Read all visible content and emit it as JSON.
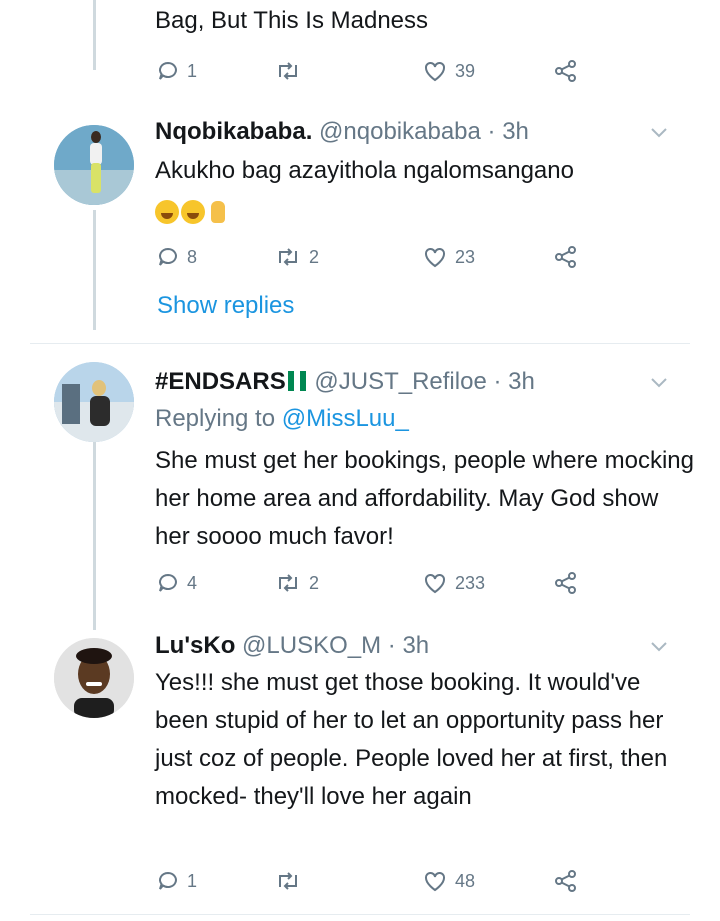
{
  "top_tweet": {
    "text_tail": "Bag, But This Is Madness",
    "replies": "1",
    "retweets": "",
    "likes": "39"
  },
  "tweets": [
    {
      "name": "Nqobikababa.",
      "handle": "@nqobikababa",
      "time": "· 3h",
      "text": "Akukho bag azayithola ngalomsangano",
      "emoji_icons": [
        "rofl-emoji",
        "rofl-emoji",
        "finger-emoji"
      ],
      "replies": "8",
      "retweets": "2",
      "likes": "23",
      "show_replies": "Show replies"
    },
    {
      "name": "#ENDSARS",
      "handle": "@JUST_Refiloe",
      "time": "· 3h",
      "replying_prefix": "Replying to",
      "replying_to": "@MissLuu_",
      "text": "She must get her bookings, people where mocking her home area and affordability. May God show her soooo much favor!",
      "replies": "4",
      "retweets": "2",
      "likes": "233"
    },
    {
      "name": "Lu'sKo",
      "handle": "@LUSKO_M",
      "time": "· 3h",
      "text": "Yes!!! she must get those booking. It would've been stupid of her to let an opportunity pass her just coz of people. People loved her at first, then mocked- they'll love her again",
      "replies": "1",
      "retweets": "",
      "likes": "48"
    }
  ],
  "colors": {
    "link": "#1b95e0",
    "muted": "#657786",
    "text": "#14171a",
    "flag_green": "#008751"
  }
}
